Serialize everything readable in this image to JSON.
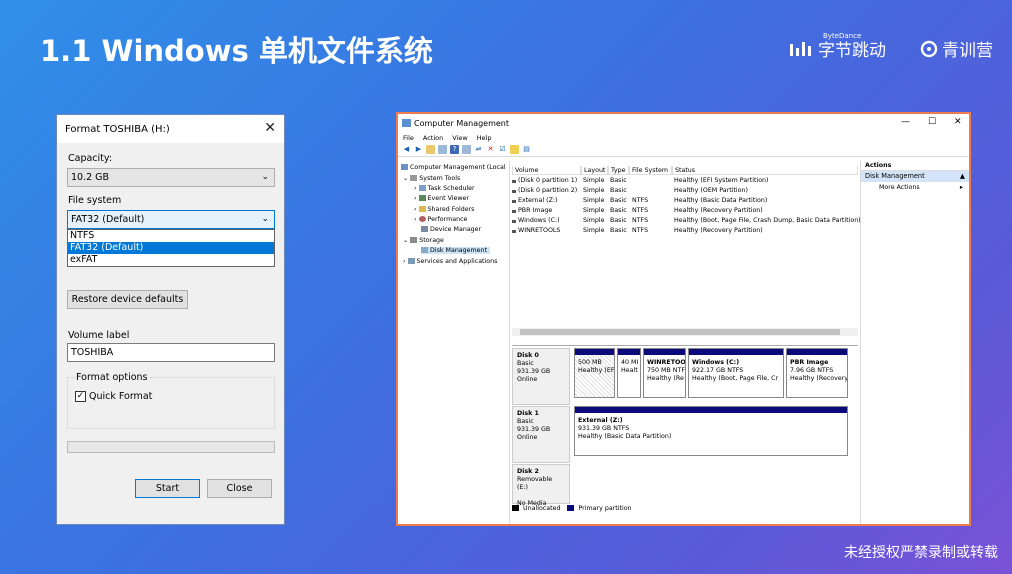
{
  "slide": {
    "title": "1.1 Windows 单机文件系统",
    "brand_small": "ByteDance",
    "brand1": "字节跳动",
    "brand2": "青训营",
    "footer": "未经授权严禁录制或转载"
  },
  "format_dialog": {
    "title": "Format TOSHIBA (H:)",
    "capacity_label": "Capacity:",
    "capacity_value": "10.2 GB",
    "filesystem_label": "File system",
    "filesystem_value": "FAT32 (Default)",
    "filesystem_options": [
      "NTFS",
      "FAT32 (Default)",
      "exFAT"
    ],
    "restore_button": "Restore device defaults",
    "volume_label": "Volume label",
    "volume_value": "TOSHIBA",
    "format_options_label": "Format options",
    "quick_format_label": "Quick Format",
    "quick_format_checked": true,
    "start_button": "Start",
    "close_button": "Close"
  },
  "computer_management": {
    "title": "Computer Management",
    "menu": [
      "File",
      "Action",
      "View",
      "Help"
    ],
    "tree": {
      "root": "Computer Management (Local",
      "system_tools": "System Tools",
      "task_scheduler": "Task Scheduler",
      "event_viewer": "Event Viewer",
      "shared_folders": "Shared Folders",
      "performance": "Performance",
      "device_manager": "Device Manager",
      "storage": "Storage",
      "disk_management": "Disk Management",
      "services": "Services and Applications"
    },
    "columns": [
      "Volume",
      "Layout",
      "Type",
      "File System",
      "Status"
    ],
    "volumes": [
      {
        "volume": "(Disk 0 partition 1)",
        "layout": "Simple",
        "type": "Basic",
        "fs": "",
        "status": "Healthy (EFI System Partition)"
      },
      {
        "volume": "(Disk 0 partition 2)",
        "layout": "Simple",
        "type": "Basic",
        "fs": "",
        "status": "Healthy (OEM Partition)"
      },
      {
        "volume": "External (Z:)",
        "layout": "Simple",
        "type": "Basic",
        "fs": "NTFS",
        "status": "Healthy (Basic Data Partition)"
      },
      {
        "volume": "PBR Image",
        "layout": "Simple",
        "type": "Basic",
        "fs": "NTFS",
        "status": "Healthy (Recovery Partition)"
      },
      {
        "volume": "Windows (C:)",
        "layout": "Simple",
        "type": "Basic",
        "fs": "NTFS",
        "status": "Healthy (Boot, Page File, Crash Dump, Basic Data Partition)"
      },
      {
        "volume": "WINRETOOLS",
        "layout": "Simple",
        "type": "Basic",
        "fs": "NTFS",
        "status": "Healthy (Recovery Partition)"
      }
    ],
    "disk0": {
      "name": "Disk 0",
      "type": "Basic",
      "size": "931.39 GB",
      "state": "Online",
      "parts": [
        {
          "l1": "",
          "l2": "500 MB",
          "l3": "Healthy (EF"
        },
        {
          "l1": "",
          "l2": "40 MI",
          "l3": "Healt"
        },
        {
          "l1": "WINRETOO",
          "l2": "750 MB NTF",
          "l3": "Healthy (Re"
        },
        {
          "l1": "Windows (C:)",
          "l2": "922.17 GB NTFS",
          "l3": "Healthy (Boot, Page File, Cr"
        },
        {
          "l1": "PBR Image",
          "l2": "7.96 GB NTFS",
          "l3": "Healthy (Recovery"
        }
      ]
    },
    "disk1": {
      "name": "Disk 1",
      "type": "Basic",
      "size": "931.39 GB",
      "state": "Online",
      "part": {
        "l1": "External (Z:)",
        "l2": "931.39 GB NTFS",
        "l3": "Healthy (Basic Data Partition)"
      }
    },
    "disk2": {
      "name": "Disk 2",
      "type": "Removable (E:)",
      "state": "No Media"
    },
    "legend": {
      "unallocated": "Unallocated",
      "primary": "Primary partition"
    },
    "actions": {
      "header": "Actions",
      "selected": "Disk Management",
      "more": "More Actions"
    }
  }
}
